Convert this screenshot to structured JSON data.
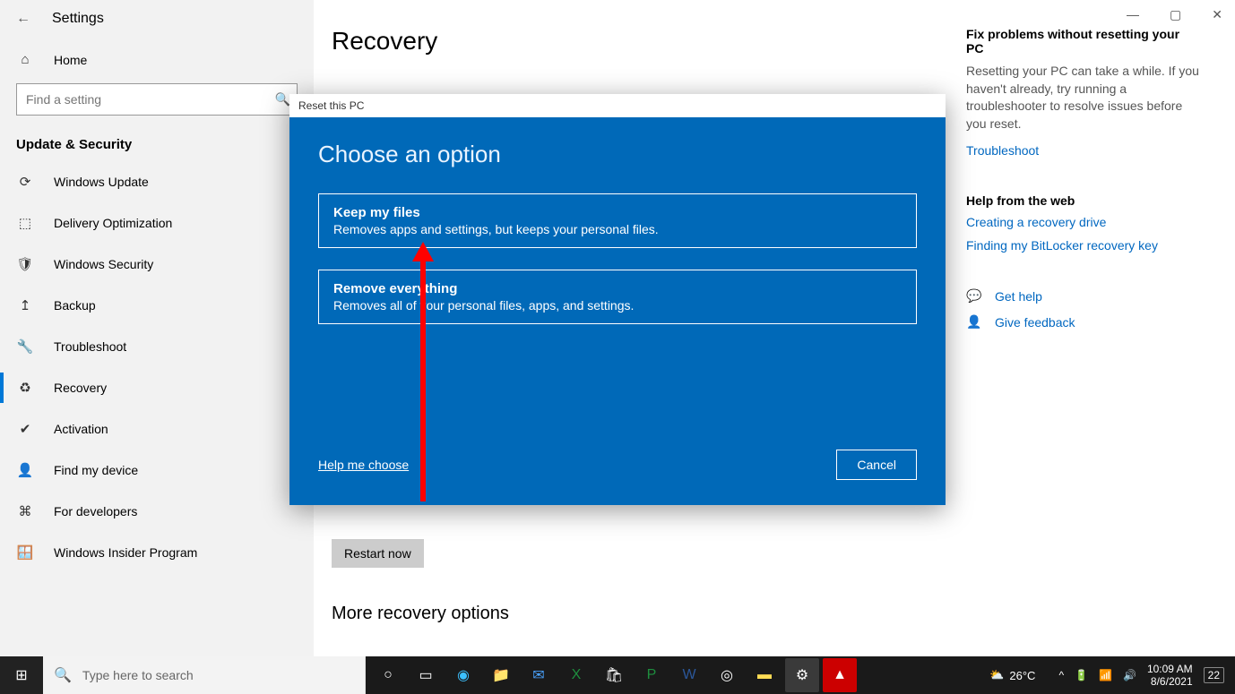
{
  "window": {
    "title": "Settings",
    "home_label": "Home",
    "search_placeholder": "Find a setting",
    "category": "Update & Security"
  },
  "sidebar": {
    "items": [
      {
        "icon": "↻",
        "label": "Windows Update"
      },
      {
        "icon": "⬚",
        "label": "Delivery Optimization"
      },
      {
        "icon": "🛡",
        "label": "Windows Security"
      },
      {
        "icon": "↥",
        "label": "Backup"
      },
      {
        "icon": "🔧",
        "label": "Troubleshoot"
      },
      {
        "icon": "♻",
        "label": "Recovery"
      },
      {
        "icon": "✔",
        "label": "Activation"
      },
      {
        "icon": "👤",
        "label": "Find my device"
      },
      {
        "icon": "⚙",
        "label": "For developers"
      },
      {
        "icon": "🪟",
        "label": "Windows Insider Program"
      }
    ]
  },
  "page": {
    "title": "Recovery",
    "restart_label": "Restart now",
    "more_title": "More recovery options"
  },
  "right": {
    "fix_heading": "Fix problems without resetting your PC",
    "fix_text": "Resetting your PC can take a while. If you haven't already, try running a troubleshooter to resolve issues before you reset.",
    "troubleshoot_link": "Troubleshoot",
    "web_heading": "Help from the web",
    "web_links": [
      "Creating a recovery drive",
      "Finding my BitLocker recovery key"
    ],
    "get_help": "Get help",
    "give_feedback": "Give feedback"
  },
  "dialog": {
    "title": "Reset this PC",
    "heading": "Choose an option",
    "options": [
      {
        "title": "Keep my files",
        "desc": "Removes apps and settings, but keeps your personal files."
      },
      {
        "title": "Remove everything",
        "desc": "Removes all of your personal files, apps, and settings."
      }
    ],
    "help_link": "Help me choose",
    "cancel": "Cancel"
  },
  "taskbar": {
    "search_placeholder": "Type here to search",
    "weather": "26°C",
    "time": "10:09 AM",
    "date": "8/6/2021",
    "notif_count": "22"
  }
}
